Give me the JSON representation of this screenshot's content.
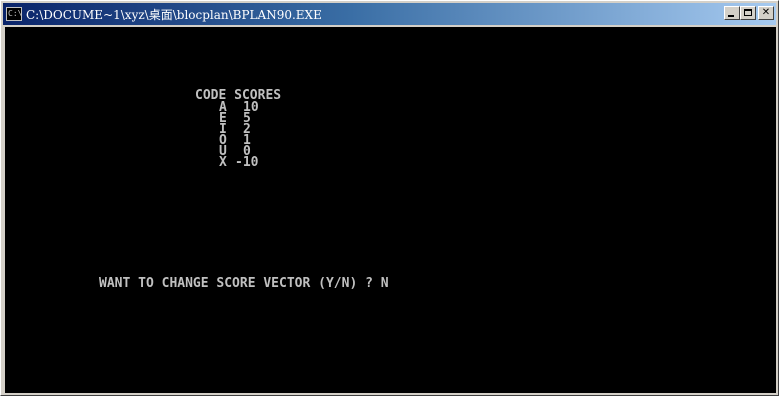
{
  "window": {
    "title": "C:\\DOCUME~1\\xyz\\桌面\\blocplan\\BPLAN90.EXE",
    "icon_label": "C:\\",
    "icon": "console-icon",
    "buttons": [
      "minimize-icon",
      "maximize-icon",
      "close-icon"
    ]
  },
  "console": {
    "header": "CODE SCORES",
    "scores": [
      {
        "code": "A",
        "score": "10"
      },
      {
        "code": "E",
        "score": "5"
      },
      {
        "code": "I",
        "score": "2"
      },
      {
        "code": "O",
        "score": "1"
      },
      {
        "code": "U",
        "score": "0"
      },
      {
        "code": "X",
        "score": "-10"
      }
    ],
    "prompt": "WANT TO CHANGE SCORE VECTOR (Y/N) ? N"
  },
  "colors": {
    "console_bg": "#000000",
    "console_text": "#c0c0c0",
    "titlebar_start": "#0a246a",
    "titlebar_end": "#a6caf0"
  }
}
